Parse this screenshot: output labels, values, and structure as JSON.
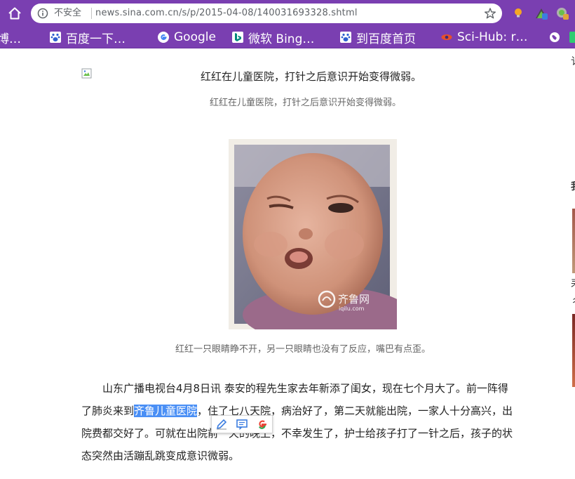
{
  "browser": {
    "security_label": "不安全",
    "url": "news.sina.com.cn/s/p/2015-04-08/140031693328.shtml",
    "bookmarks": [
      {
        "label": "博…",
        "icon": "weibo-icon"
      },
      {
        "label": "百度一下…",
        "icon": "baidu-paw-icon"
      },
      {
        "label": "Google",
        "icon": "google-icon"
      },
      {
        "label": "微软 Bing…",
        "icon": "bing-icon"
      },
      {
        "label": "到百度首页",
        "icon": "baidu-paw-icon"
      },
      {
        "label": "Sci-Hub: r…",
        "icon": "scihub-eye-icon"
      }
    ]
  },
  "article": {
    "img_caption": "红红在儿童医院，打针之后意识开始变得微弱。",
    "img_caption_sub": "红红在儿童医院，打针之后意识开始变得微弱。",
    "photo_watermark_cn": "齐鲁网",
    "photo_watermark_en": "iqilu.com",
    "photo_caption": "红红一只眼睛睁不开，另一只眼睛也没有了反应，嘴巴有点歪。",
    "para": {
      "line1": "山东广播电视台4月8日讯 泰安的程先生家去年新添了闺女，现在七个月大了。前一阵得",
      "line2_pre": "了肺炎来到",
      "line2_hl": "齐鲁儿童医院",
      "line2_post": "，住了七八天院，病治好了，第二天就能出院，一家人十分高兴，出",
      "line3_pre": "院费都交好了。可就在出院前",
      "line3_post": "一天的晚上，不幸发生了，护士给孩子打了一针之后，孩子的状",
      "line4": "态突然由活蹦乱跳变成意识微弱。"
    }
  },
  "right_strip": {
    "chars": [
      "讠",
      "我",
      "耒",
      "彳"
    ]
  }
}
